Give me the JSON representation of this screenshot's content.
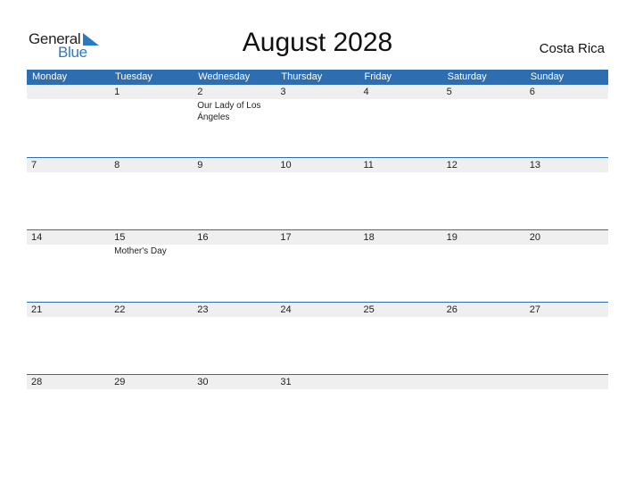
{
  "logo": {
    "general": "General",
    "blue": "Blue",
    "brand_color": "#2a7bc1"
  },
  "header": {
    "title": "August 2028",
    "country": "Costa Rica"
  },
  "colors": {
    "header_band": "#2e6db0",
    "date_strip": "#efefef"
  },
  "weekdays": [
    "Monday",
    "Tuesday",
    "Wednesday",
    "Thursday",
    "Friday",
    "Saturday",
    "Sunday"
  ],
  "weeks": [
    {
      "days": [
        "",
        "1",
        "2",
        "3",
        "4",
        "5",
        "6"
      ],
      "events": [
        "",
        "",
        "Our Lady of Los Ángeles",
        "",
        "",
        "",
        ""
      ]
    },
    {
      "days": [
        "7",
        "8",
        "9",
        "10",
        "11",
        "12",
        "13"
      ],
      "events": [
        "",
        "",
        "",
        "",
        "",
        "",
        ""
      ]
    },
    {
      "days": [
        "14",
        "15",
        "16",
        "17",
        "18",
        "19",
        "20"
      ],
      "events": [
        "",
        "Mother's Day",
        "",
        "",
        "",
        "",
        ""
      ]
    },
    {
      "days": [
        "21",
        "22",
        "23",
        "24",
        "25",
        "26",
        "27"
      ],
      "events": [
        "",
        "",
        "",
        "",
        "",
        "",
        ""
      ]
    },
    {
      "days": [
        "28",
        "29",
        "30",
        "31",
        "",
        "",
        ""
      ],
      "events": [
        "",
        "",
        "",
        "",
        "",
        "",
        ""
      ]
    }
  ]
}
